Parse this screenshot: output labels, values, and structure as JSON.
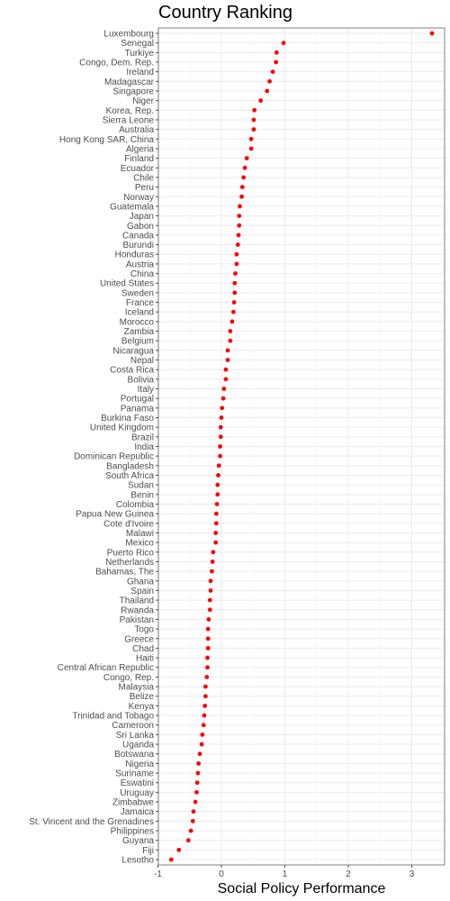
{
  "chart_data": {
    "type": "scatter",
    "title": "Country Ranking",
    "xlabel": "Social Policy Performance",
    "ylabel": "",
    "xlim": [
      -1,
      3.5
    ],
    "xticks": [
      -1,
      0,
      1,
      2,
      3
    ],
    "xtick_labels": [
      "-1",
      "0",
      "1",
      "2",
      "3"
    ],
    "grid": true,
    "point_color": "#ff0000",
    "categories": [
      "Luxembourg",
      "Senegal",
      "Turkiye",
      "Congo, Dem. Rep.",
      "Ireland",
      "Madagascar",
      "Singapore",
      "Niger",
      "Korea, Rep.",
      "Sierra Leone",
      "Australia",
      "Hong Kong SAR, China",
      "Algeria",
      "Finland",
      "Ecuador",
      "Chile",
      "Peru",
      "Norway",
      "Guatemala",
      "Japan",
      "Gabon",
      "Canada",
      "Burundi",
      "Honduras",
      "Austria",
      "China",
      "United States",
      "Sweden",
      "France",
      "Iceland",
      "Morocco",
      "Zambia",
      "Belgium",
      "Nicaragua",
      "Nepal",
      "Costa Rica",
      "Bolivia",
      "Italy",
      "Portugal",
      "Panama",
      "Burkina Faso",
      "United Kingdom",
      "Brazil",
      "India",
      "Dominican Republic",
      "Bangladesh",
      "South Africa",
      "Sudan",
      "Benin",
      "Colombia",
      "Papua New Guinea",
      "Cote d'Ivoire",
      "Malawi",
      "Mexico",
      "Puerto Rico",
      "Netherlands",
      "Bahamas, The",
      "Ghana",
      "Spain",
      "Thailand",
      "Rwanda",
      "Pakistan",
      "Togo",
      "Greece",
      "Chad",
      "Haiti",
      "Central African Republic",
      "Congo, Rep.",
      "Malaysia",
      "Belize",
      "Kenya",
      "Trinidad and Tobago",
      "Cameroon",
      "Sri Lanka",
      "Uganda",
      "Botswana",
      "Nigeria",
      "Suriname",
      "Eswatini",
      "Uruguay",
      "Zimbabwe",
      "Jamaica",
      "St. Vincent and the Grenadines",
      "Philippines",
      "Guyana",
      "Fiji",
      "Lesotho"
    ],
    "values": [
      3.32,
      0.98,
      0.87,
      0.86,
      0.81,
      0.76,
      0.72,
      0.62,
      0.52,
      0.51,
      0.51,
      0.47,
      0.47,
      0.4,
      0.37,
      0.35,
      0.33,
      0.32,
      0.29,
      0.28,
      0.28,
      0.27,
      0.26,
      0.24,
      0.24,
      0.22,
      0.21,
      0.21,
      0.2,
      0.19,
      0.17,
      0.14,
      0.14,
      0.1,
      0.1,
      0.07,
      0.07,
      0.04,
      0.03,
      0.01,
      0.0,
      -0.01,
      -0.01,
      -0.02,
      -0.02,
      -0.04,
      -0.05,
      -0.06,
      -0.06,
      -0.07,
      -0.08,
      -0.08,
      -0.09,
      -0.09,
      -0.13,
      -0.14,
      -0.15,
      -0.17,
      -0.17,
      -0.18,
      -0.18,
      -0.2,
      -0.21,
      -0.21,
      -0.21,
      -0.22,
      -0.22,
      -0.23,
      -0.25,
      -0.25,
      -0.26,
      -0.27,
      -0.28,
      -0.3,
      -0.31,
      -0.34,
      -0.36,
      -0.37,
      -0.38,
      -0.39,
      -0.41,
      -0.44,
      -0.45,
      -0.48,
      -0.52,
      -0.67,
      -0.79
    ]
  }
}
